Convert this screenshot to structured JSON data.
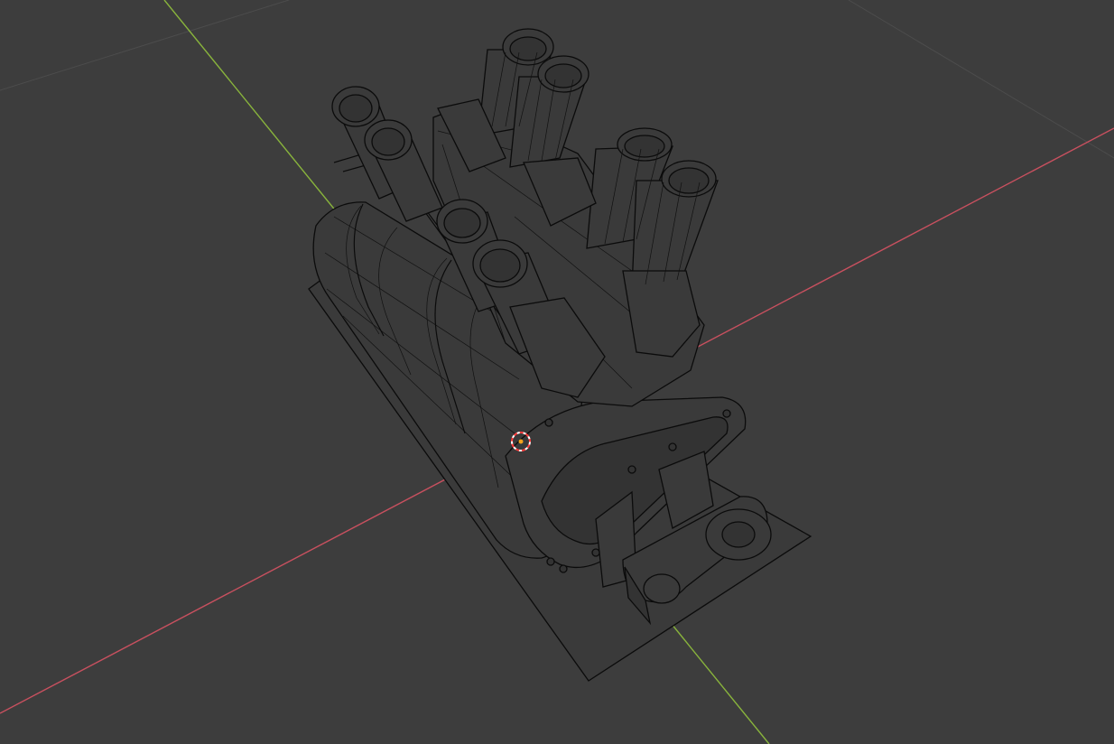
{
  "viewport": {
    "background": "#3d3d3d",
    "axis_x_color": "#c8505f",
    "axis_y_color": "#89b43c",
    "wire_color": "#0b0b0b",
    "cursor_color": "#ff3b3b"
  },
  "scene": {
    "mode": "wireframe",
    "object": "engine-with-carburetor-stacks",
    "icons": [
      "3d-cursor-icon",
      "origin-dot-icon"
    ]
  }
}
